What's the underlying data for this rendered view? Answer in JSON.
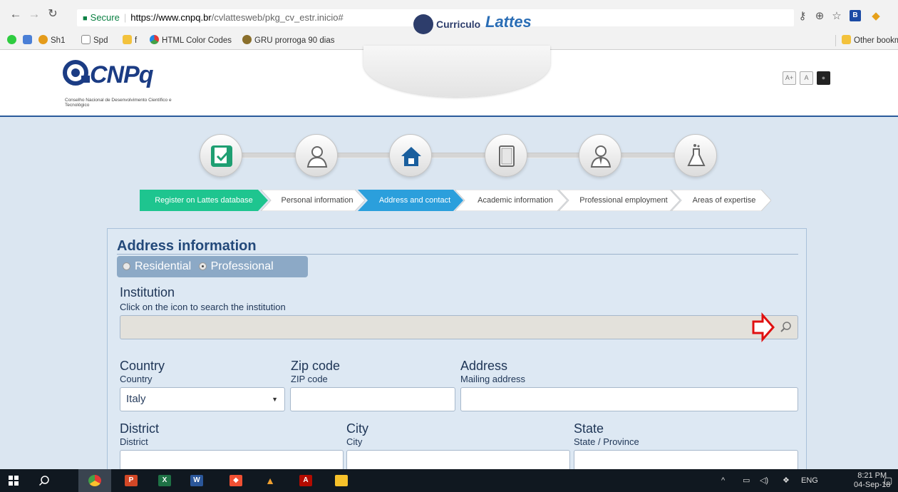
{
  "browser": {
    "url_secure": "Secure",
    "url_domain": "https://www.cnpq.br",
    "url_path": "/cvlattesweb/pkg_cv_estr.inicio#",
    "bookmarks": [
      "Sh1",
      "Spd",
      "f",
      "HTML Color Codes",
      "GRU prorroga 90 dias"
    ],
    "other_bookmarks": "Other bookma",
    "profile_badge": "B"
  },
  "header": {
    "logo_text": "CNPq",
    "logo_subtitle": "Conselho Nacional de Desenvolvimento Científico e Tecnológico",
    "app_name_prefix": "Curriculo",
    "app_name": "Lattes",
    "font_buttons": [
      "A+",
      "A",
      "■"
    ]
  },
  "steps": [
    {
      "icon": "checklist-icon",
      "label": "Register on Lattes database",
      "state": "done",
      "color": "#1ec58f"
    },
    {
      "icon": "person-icon",
      "label": "Personal information",
      "state": "todo"
    },
    {
      "icon": "house-icon",
      "label": "Address and contact",
      "state": "current",
      "color": "#2b9fdc"
    },
    {
      "icon": "book-icon",
      "label": "Academic information",
      "state": "todo"
    },
    {
      "icon": "professional-icon",
      "label": "Professional employment",
      "state": "todo"
    },
    {
      "icon": "flask-icon",
      "label": "Areas of expertise",
      "state": "todo"
    }
  ],
  "form": {
    "section_title": "Address information",
    "radio_options": [
      "Residential",
      "Professional"
    ],
    "radio_selected": "Professional",
    "institution": {
      "label": "Institution",
      "hint": "Click on the icon to search the institution",
      "value": ""
    },
    "country": {
      "label": "Country",
      "hint": "Country",
      "value": "Italy"
    },
    "zip": {
      "label": "Zip code",
      "hint": "ZIP code",
      "value": ""
    },
    "address": {
      "label": "Address",
      "hint": "Mailing address",
      "value": ""
    },
    "district": {
      "label": "District",
      "hint": "District",
      "value": ""
    },
    "city": {
      "label": "City",
      "hint": "City",
      "value": ""
    },
    "state": {
      "label": "State",
      "hint": "State / Province",
      "value": ""
    }
  },
  "taskbar": {
    "language": "ENG",
    "time": "8:21 PM",
    "date": "04-Sep-18"
  }
}
